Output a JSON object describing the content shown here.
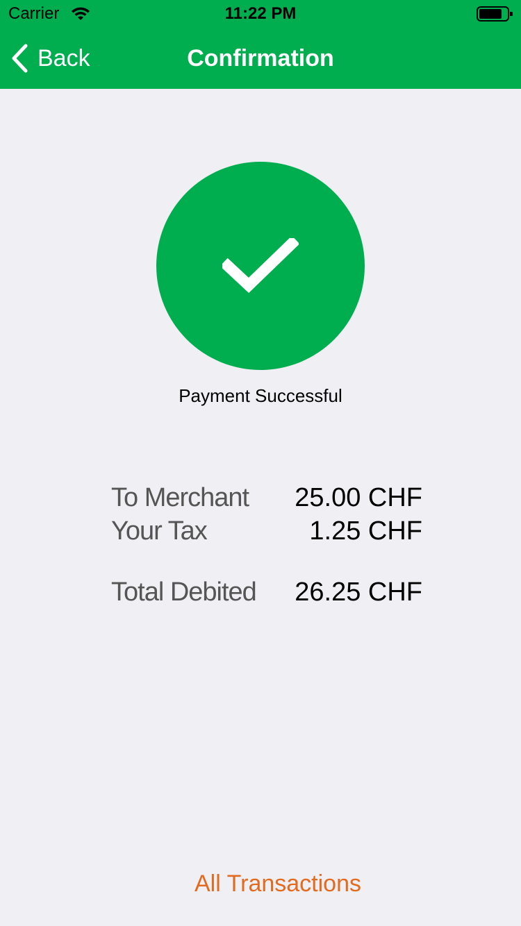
{
  "status_bar": {
    "carrier": "Carrier",
    "time": "11:22 PM"
  },
  "nav": {
    "back_label": "Back",
    "title": "Confirmation"
  },
  "success": {
    "message": "Payment Successful"
  },
  "summary": {
    "merchant_label": "To Merchant",
    "merchant_value": "25.00 CHF",
    "tax_label": "Your Tax",
    "tax_value": "1.25 CHF",
    "total_label": "Total Debited",
    "total_value": "26.25 CHF"
  },
  "footer": {
    "all_transactions_label": "All Transactions"
  },
  "colors": {
    "brand_green": "#00ad4f",
    "link_orange": "#e36b1f",
    "background": "#efeff4"
  },
  "icons": {
    "signal": "wifi-icon",
    "battery": "battery-icon",
    "back": "chevron-left-icon",
    "success": "checkmark-icon"
  }
}
